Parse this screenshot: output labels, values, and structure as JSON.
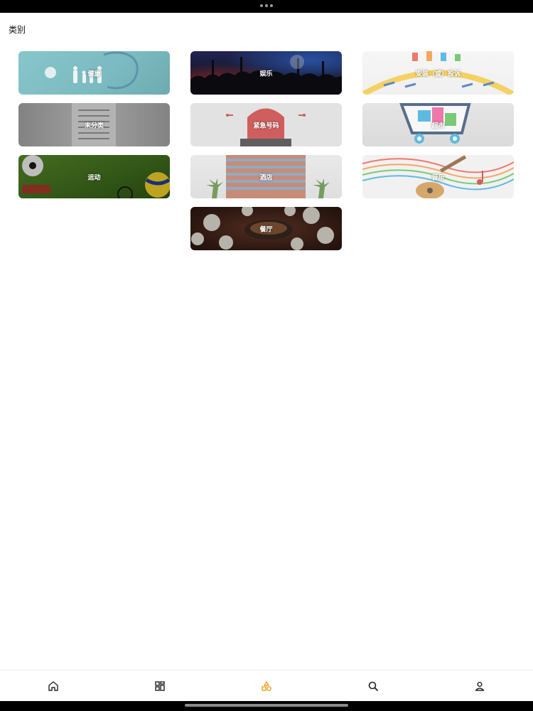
{
  "page": {
    "title": "类别"
  },
  "colors": {
    "accent": "#f0a020",
    "icon": "#222222"
  },
  "categories": [
    {
      "label": "健康",
      "image": "health-image"
    },
    {
      "label": "娱乐",
      "image": "entertainment-image"
    },
    {
      "label": "安装（或）投诉",
      "image": "installation-image"
    },
    {
      "label": "未分类",
      "image": "uncategorized-image"
    },
    {
      "label": "紧急号码",
      "image": "emergency-image"
    },
    {
      "label": "超市",
      "image": "supermarket-image"
    },
    {
      "label": "运动",
      "image": "sports-image"
    },
    {
      "label": "酒店",
      "image": "hotel-image"
    },
    {
      "label": "音乐",
      "image": "music-image"
    },
    {
      "label": "餐厅",
      "image": "restaurant-image"
    }
  ],
  "nav": [
    {
      "icon": "home-icon",
      "active": false
    },
    {
      "icon": "grid-icon",
      "active": false
    },
    {
      "icon": "categories-icon",
      "active": true
    },
    {
      "icon": "search-icon",
      "active": false
    },
    {
      "icon": "profile-icon",
      "active": false
    }
  ]
}
